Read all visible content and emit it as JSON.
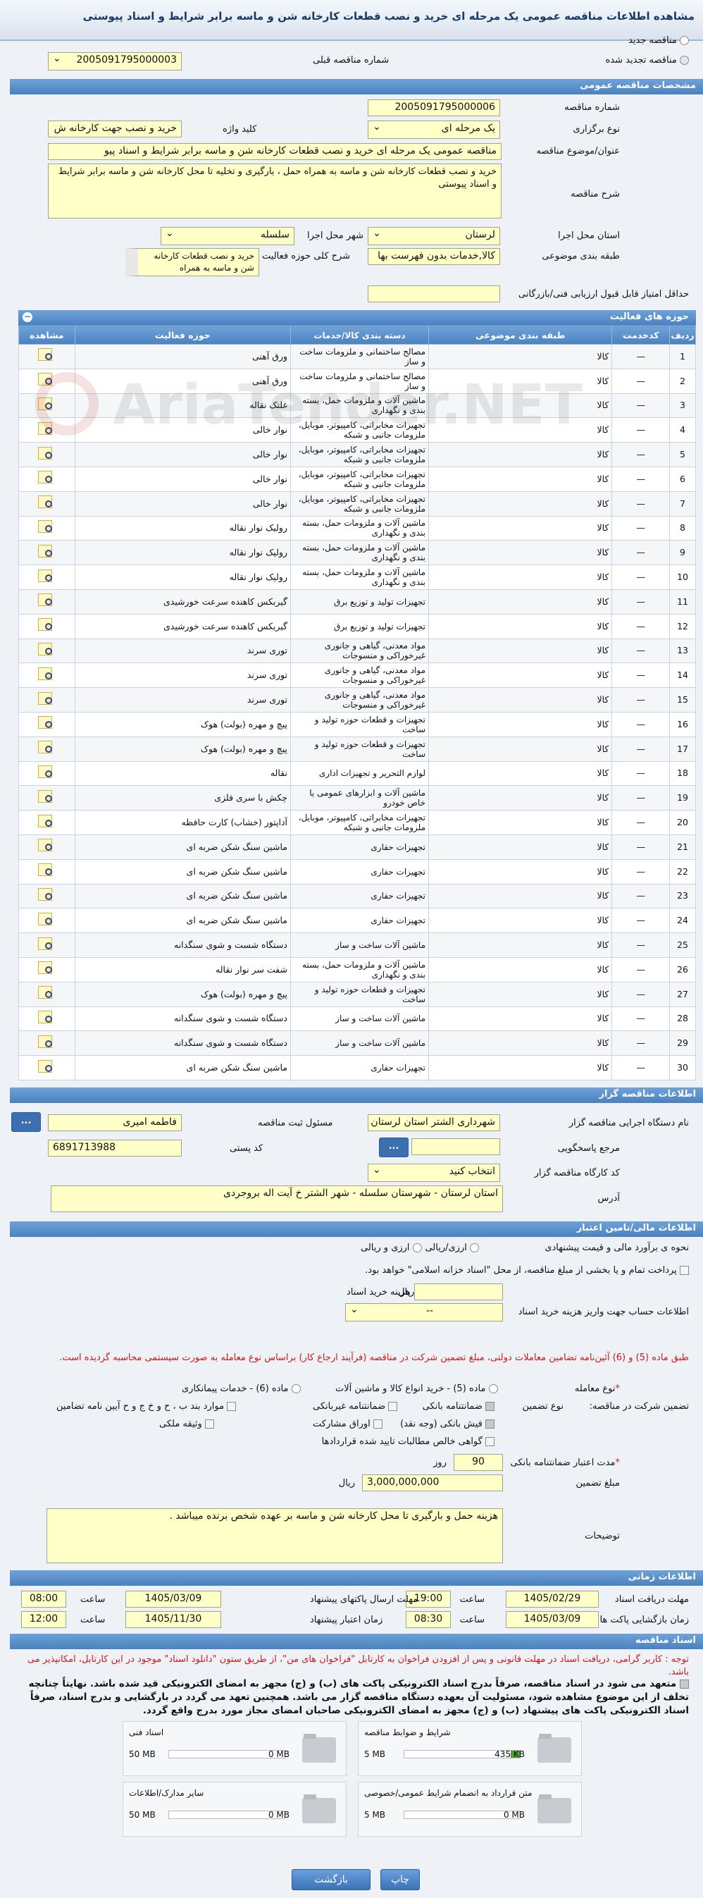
{
  "page": {
    "title": "مشاهده اطلاعات مناقصه عمومی یک مرحله ای خرید و نصب قطعات کارخانه شن و ماسه برابر شرایط و اسناد پیوستی"
  },
  "tender_type": {
    "new_label": "مناقصه جدید",
    "renewed_label": "مناقصه تجدید شده",
    "prev_number_label": "شماره مناقصه قبلی",
    "prev_number_value": "2005091795000003"
  },
  "general": {
    "section_title": "مشخصات مناقصه عمومی",
    "number_label": "شماره مناقصه",
    "number_value": "2005091795000006",
    "holding_type_label": "نوع برگزاری",
    "holding_type_value": "یک مرحله ای",
    "keyword_label": "کلید واژه",
    "keyword_value": "خرید و نصب جهت کارخانه ش",
    "subject_label": "عنوان/موضوع مناقصه",
    "subject_value": "مناقصه عمومی یک مرحله ای خرید و نصب قطعات کارخانه شن و ماسه برابر شرایط و اسناد پیو",
    "description_label": "شرح مناقصه",
    "description_value": "خرید و نصب قطعات کارخانه شن و ماسه به همراه حمل ، بارگیری و تخلیه تا محل کارخانه شن و ماسه برابر شرایط و اسناد پیوستی",
    "province_label": "استان محل اجرا",
    "province_value": "لرستان",
    "city_label": "شهر محل اجرا",
    "city_value": "سلسله",
    "category_label": "طبقه بندی موضوعی",
    "category_value": "کالا,خدمات بدون فهرست بها",
    "activity_desc_label": "شرح کلی حوزه فعالیت",
    "activity_desc_value": "خرید و نصب قطعات کارخانه شن و ماسه به همراه",
    "min_score_label": "حداقل امتیاز قابل قبول ارزیابی فنی/بازرگانی",
    "min_score_value": ""
  },
  "activities": {
    "section_title": "حوزه های فعالیت",
    "headers": [
      "ردیف",
      "کدخدمت",
      "طبقه بندی موضوعی",
      "دسته بندی کالا/خدمات",
      "حوزه فعالیت",
      "مشاهده"
    ],
    "rows": [
      {
        "row": "1",
        "code": "—",
        "cat": "کالا",
        "group": "مصالح ساختمانی و ملزومات ساخت و ساز",
        "activity": "ورق آهنی"
      },
      {
        "row": "2",
        "code": "—",
        "cat": "کالا",
        "group": "مصالح ساختمانی و ملزومات ساخت و ساز",
        "activity": "ورق آهنی"
      },
      {
        "row": "3",
        "code": "—",
        "cat": "کالا",
        "group": "ماشین آلات و ملزومات حمل، بسته بندی و نگهداری",
        "activity": "غلتک نقاله"
      },
      {
        "row": "4",
        "code": "—",
        "cat": "کالا",
        "group": "تجهیزات مخابراتی، کامپیوتر، موبایل، ملزومات جانبی و شبکه",
        "activity": "نوار خالی"
      },
      {
        "row": "5",
        "code": "—",
        "cat": "کالا",
        "group": "تجهیزات مخابراتی، کامپیوتر، موبایل، ملزومات جانبی و شبکه",
        "activity": "نوار خالی"
      },
      {
        "row": "6",
        "code": "—",
        "cat": "کالا",
        "group": "تجهیزات مخابراتی، کامپیوتر، موبایل، ملزومات جانبی و شبکه",
        "activity": "نوار خالی"
      },
      {
        "row": "7",
        "code": "—",
        "cat": "کالا",
        "group": "تجهیزات مخابراتی، کامپیوتر، موبایل، ملزومات جانبی و شبکه",
        "activity": "نوار خالی"
      },
      {
        "row": "8",
        "code": "—",
        "cat": "کالا",
        "group": "ماشین آلات و ملزومات حمل، بسته بندی و نگهداری",
        "activity": "رولیک نوار نقاله"
      },
      {
        "row": "9",
        "code": "—",
        "cat": "کالا",
        "group": "ماشین آلات و ملزومات حمل، بسته بندی و نگهداری",
        "activity": "رولیک نوار نقاله"
      },
      {
        "row": "10",
        "code": "—",
        "cat": "کالا",
        "group": "ماشین آلات و ملزومات حمل، بسته بندی و نگهداری",
        "activity": "رولیک نوار نقاله"
      },
      {
        "row": "11",
        "code": "—",
        "cat": "کالا",
        "group": "تجهیزات تولید و توزیع برق",
        "activity": "گیربکس کاهنده سرعت خورشیدی"
      },
      {
        "row": "12",
        "code": "—",
        "cat": "کالا",
        "group": "تجهیزات تولید و توزیع برق",
        "activity": "گیربکس کاهنده سرعت خورشیدی"
      },
      {
        "row": "13",
        "code": "—",
        "cat": "کالا",
        "group": "مواد معدنی، گیاهی و جانوری غیرخوراکی و منسوجات",
        "activity": "توری سرند"
      },
      {
        "row": "14",
        "code": "—",
        "cat": "کالا",
        "group": "مواد معدنی، گیاهی و جانوری غیرخوراکی و منسوجات",
        "activity": "توری سرند"
      },
      {
        "row": "15",
        "code": "—",
        "cat": "کالا",
        "group": "مواد معدنی، گیاهی و جانوری غیرخوراکی و منسوجات",
        "activity": "توری سرند"
      },
      {
        "row": "16",
        "code": "—",
        "cat": "کالا",
        "group": "تجهیزات و قطعات حوزه تولید و ساخت",
        "activity": "پیچ و مهره (بولت) هوک"
      },
      {
        "row": "17",
        "code": "—",
        "cat": "کالا",
        "group": "تجهیزات و قطعات حوزه تولید و ساخت",
        "activity": "پیچ و مهره (بولت) هوک"
      },
      {
        "row": "18",
        "code": "—",
        "cat": "کالا",
        "group": "لوازم التحریر و تجهیزات اداری",
        "activity": "نقاله"
      },
      {
        "row": "19",
        "code": "—",
        "cat": "کالا",
        "group": "ماشین آلات و ابزارهای عمومی یا خاص خودرو",
        "activity": "چکش با سری فلزی"
      },
      {
        "row": "20",
        "code": "—",
        "cat": "کالا",
        "group": "تجهیزات مخابراتی، کامپیوتر، موبایل، ملزومات جانبی و شبکه",
        "activity": "آداپتور (خشاب) کارت حافظه"
      },
      {
        "row": "21",
        "code": "—",
        "cat": "کالا",
        "group": "تجهیزات حفاری",
        "activity": "ماشین سنگ شکن ضربه ای"
      },
      {
        "row": "22",
        "code": "—",
        "cat": "کالا",
        "group": "تجهیزات حفاری",
        "activity": "ماشین سنگ شکن ضربه ای"
      },
      {
        "row": "23",
        "code": "—",
        "cat": "کالا",
        "group": "تجهیزات حفاری",
        "activity": "ماشین سنگ شکن ضربه ای"
      },
      {
        "row": "24",
        "code": "—",
        "cat": "کالا",
        "group": "تجهیزات حفاری",
        "activity": "ماشین سنگ شکن ضربه ای"
      },
      {
        "row": "25",
        "code": "—",
        "cat": "کالا",
        "group": "ماشین آلات ساخت و ساز",
        "activity": "دستگاه شست و شوی سنگدانه"
      },
      {
        "row": "26",
        "code": "—",
        "cat": "کالا",
        "group": "ماشین آلات و ملزومات حمل، بسته بندی و نگهداری",
        "activity": "شفت سر نوار نقاله"
      },
      {
        "row": "27",
        "code": "—",
        "cat": "کالا",
        "group": "تجهیزات و قطعات حوزه تولید و ساخت",
        "activity": "پیچ و مهره (بولت) هوک"
      },
      {
        "row": "28",
        "code": "—",
        "cat": "کالا",
        "group": "ماشین آلات ساخت و ساز",
        "activity": "دستگاه شست و شوی سنگدانه"
      },
      {
        "row": "29",
        "code": "—",
        "cat": "کالا",
        "group": "ماشین آلات ساخت و ساز",
        "activity": "دستگاه شست و شوی سنگدانه"
      },
      {
        "row": "30",
        "code": "—",
        "cat": "کالا",
        "group": "تجهیزات حفاری",
        "activity": "ماشین سنگ شکن ضربه ای"
      }
    ]
  },
  "organizer": {
    "section_title": "اطلاعات مناقصه گزار",
    "org_name_label": "نام دستگاه اجرایی مناقصه گزار",
    "org_name_value": "شهرداری الشتر استان لرستان",
    "responsible_label": "مسئول ثبت مناقصه",
    "responsible_value": "فاطمه امیری",
    "reference_label": "مرجع پاسخگویی",
    "reference_value": "",
    "postal_label": "کد پستی",
    "postal_value": "6891713988",
    "workshop_label": "کد کارگاه مناقصه گزار",
    "workshop_value": "انتخاب کنید",
    "address_label": "آدرس",
    "address_value": "استان لرستان - شهرستان سلسله - شهر الشتر  خ آیت اله بروجردی",
    "dots": "..."
  },
  "finance": {
    "section_title": "اطلاعات مالی/تامین اعتبار",
    "estimate_label": "نحوه ی برآورد مالی و قیمت پیشنهادی",
    "estimate_opt1": "ارزی/ریالی",
    "estimate_opt2": "ارزی و ریالی",
    "payment_text": "پرداخت تمام و یا بخشی از مبلغ مناقصه، از محل \"اسناد خزانه اسلامی\" خواهد بود.",
    "doc_cost_label": "هزینه خرید اسناد",
    "doc_cost_unit": "ریال",
    "account_label": "اطلاعات حساب جهت واریز هزینه خرید اسناد",
    "account_value": "--",
    "red_note": "طبق ماده (5) و (6) آئین‌نامه تضامین معاملات دولتی، مبلغ تضمین شرکت در مناقصه (فرآیند ارجاع کار) براساس نوع معامله به صورت سیستمی محاسبه گردیده است.",
    "deal_type_label": "نوع معامله",
    "deal_opt1": "ماده (5) - خرید انواع کالا و ماشین آلات",
    "deal_opt2": "ماده (6) - خدمات پیمانکاری",
    "guarantee_label": "تضمین شرکت در مناقصه:",
    "guarantee_type_label": "نوع تضمین",
    "g_bank": "ضمانتنامه بانکی",
    "g_nonbank": "ضمانتنامه غیربانکی",
    "g_items": "موارد بند ب ، ح و خ ج و ح آیین نامه تضامین",
    "g_check": "فیش بانکی (وجه نقد)",
    "g_bonds": "اوراق مشارکت",
    "g_property": "وثیقه ملکی",
    "g_receivables": "گواهی خالص مطالبات تایید شده قراردادها",
    "validity_label": "مدت اعتبار ضمانتنامه بانکی",
    "validity_value": "90",
    "validity_unit": "روز",
    "amount_label": "مبلغ تضمین",
    "amount_value": "3,000,000,000",
    "amount_unit": "ریال",
    "notes_label": "توضیحات",
    "notes_value": "هزینه حمل و بارگیری تا محل کارخانه شن و ماسه بر عهده شخص برنده میباشد ."
  },
  "timing": {
    "section_title": "اطلاعات زمانی",
    "doc_deadline_label": "مهلت دریافت اسناد",
    "doc_deadline_date": "1405/02/29",
    "doc_deadline_time": "19:00",
    "submit_deadline_label": "مهلت ارسال پاکتهای پیشنهاد",
    "submit_deadline_date": "1405/03/09",
    "submit_deadline_time": "08:00",
    "opening_label": "زمان بازگشایی پاکت ها",
    "opening_date": "1405/03/09",
    "opening_time": "08:30",
    "validity_label": "زمان اعتبار پیشنهاد",
    "validity_date": "1405/11/30",
    "validity_time": "12:00",
    "time_label": "ساعت"
  },
  "documents": {
    "section_title": "اسناد مناقصه",
    "red_note": "توجه : کاربر گرامی، دریافت اسناد در مهلت قانونی و پس از افزودن فراخوان به کارتابل \"فراخوان های من\"، از طریق ستون \"دانلود اسناد\" موجود در این کارتابل، امکانپذیر می باشد.",
    "commitment": "متعهد می شود در اسناد مناقصه، صرفاً بدرج اسناد الکترونیکی پاکت های (ب) و (ج) مجهز به امضای الکترونیکی قید شده باشد. نهایتاً چنانچه تخلف از این موضوع مشاهده شود، مسئولیت آن بعهده دستگاه مناقصه گزار می باشد. همچنین تعهد می گردد در بارگشایی و بدرج اسناد، صرفاً اسناد الکترونیکی پاکت های پیشنهاد (ب) و (ج) مجهز به امضای الکترونیکی صاحبان امضای مجاز مورد بدرج واقع گردد.",
    "files": [
      {
        "name": "شرایط و ضوابط مناقصه",
        "used": "435 KB",
        "max": "5 MB",
        "fill": 0.08
      },
      {
        "name": "اسناد فنی",
        "used": "0 MB",
        "max": "50 MB",
        "fill": 0
      },
      {
        "name": "متن قرارداد به انضمام شرایط عمومی/خصوصی",
        "used": "0 MB",
        "max": "5 MB",
        "fill": 0
      },
      {
        "name": "سایر مدارک/اطلاعات",
        "used": "0 MB",
        "max": "50 MB",
        "fill": 0
      }
    ]
  },
  "actions": {
    "back": "بازگشت",
    "print": "چاپ"
  },
  "watermark": "AriaTender.NET"
}
